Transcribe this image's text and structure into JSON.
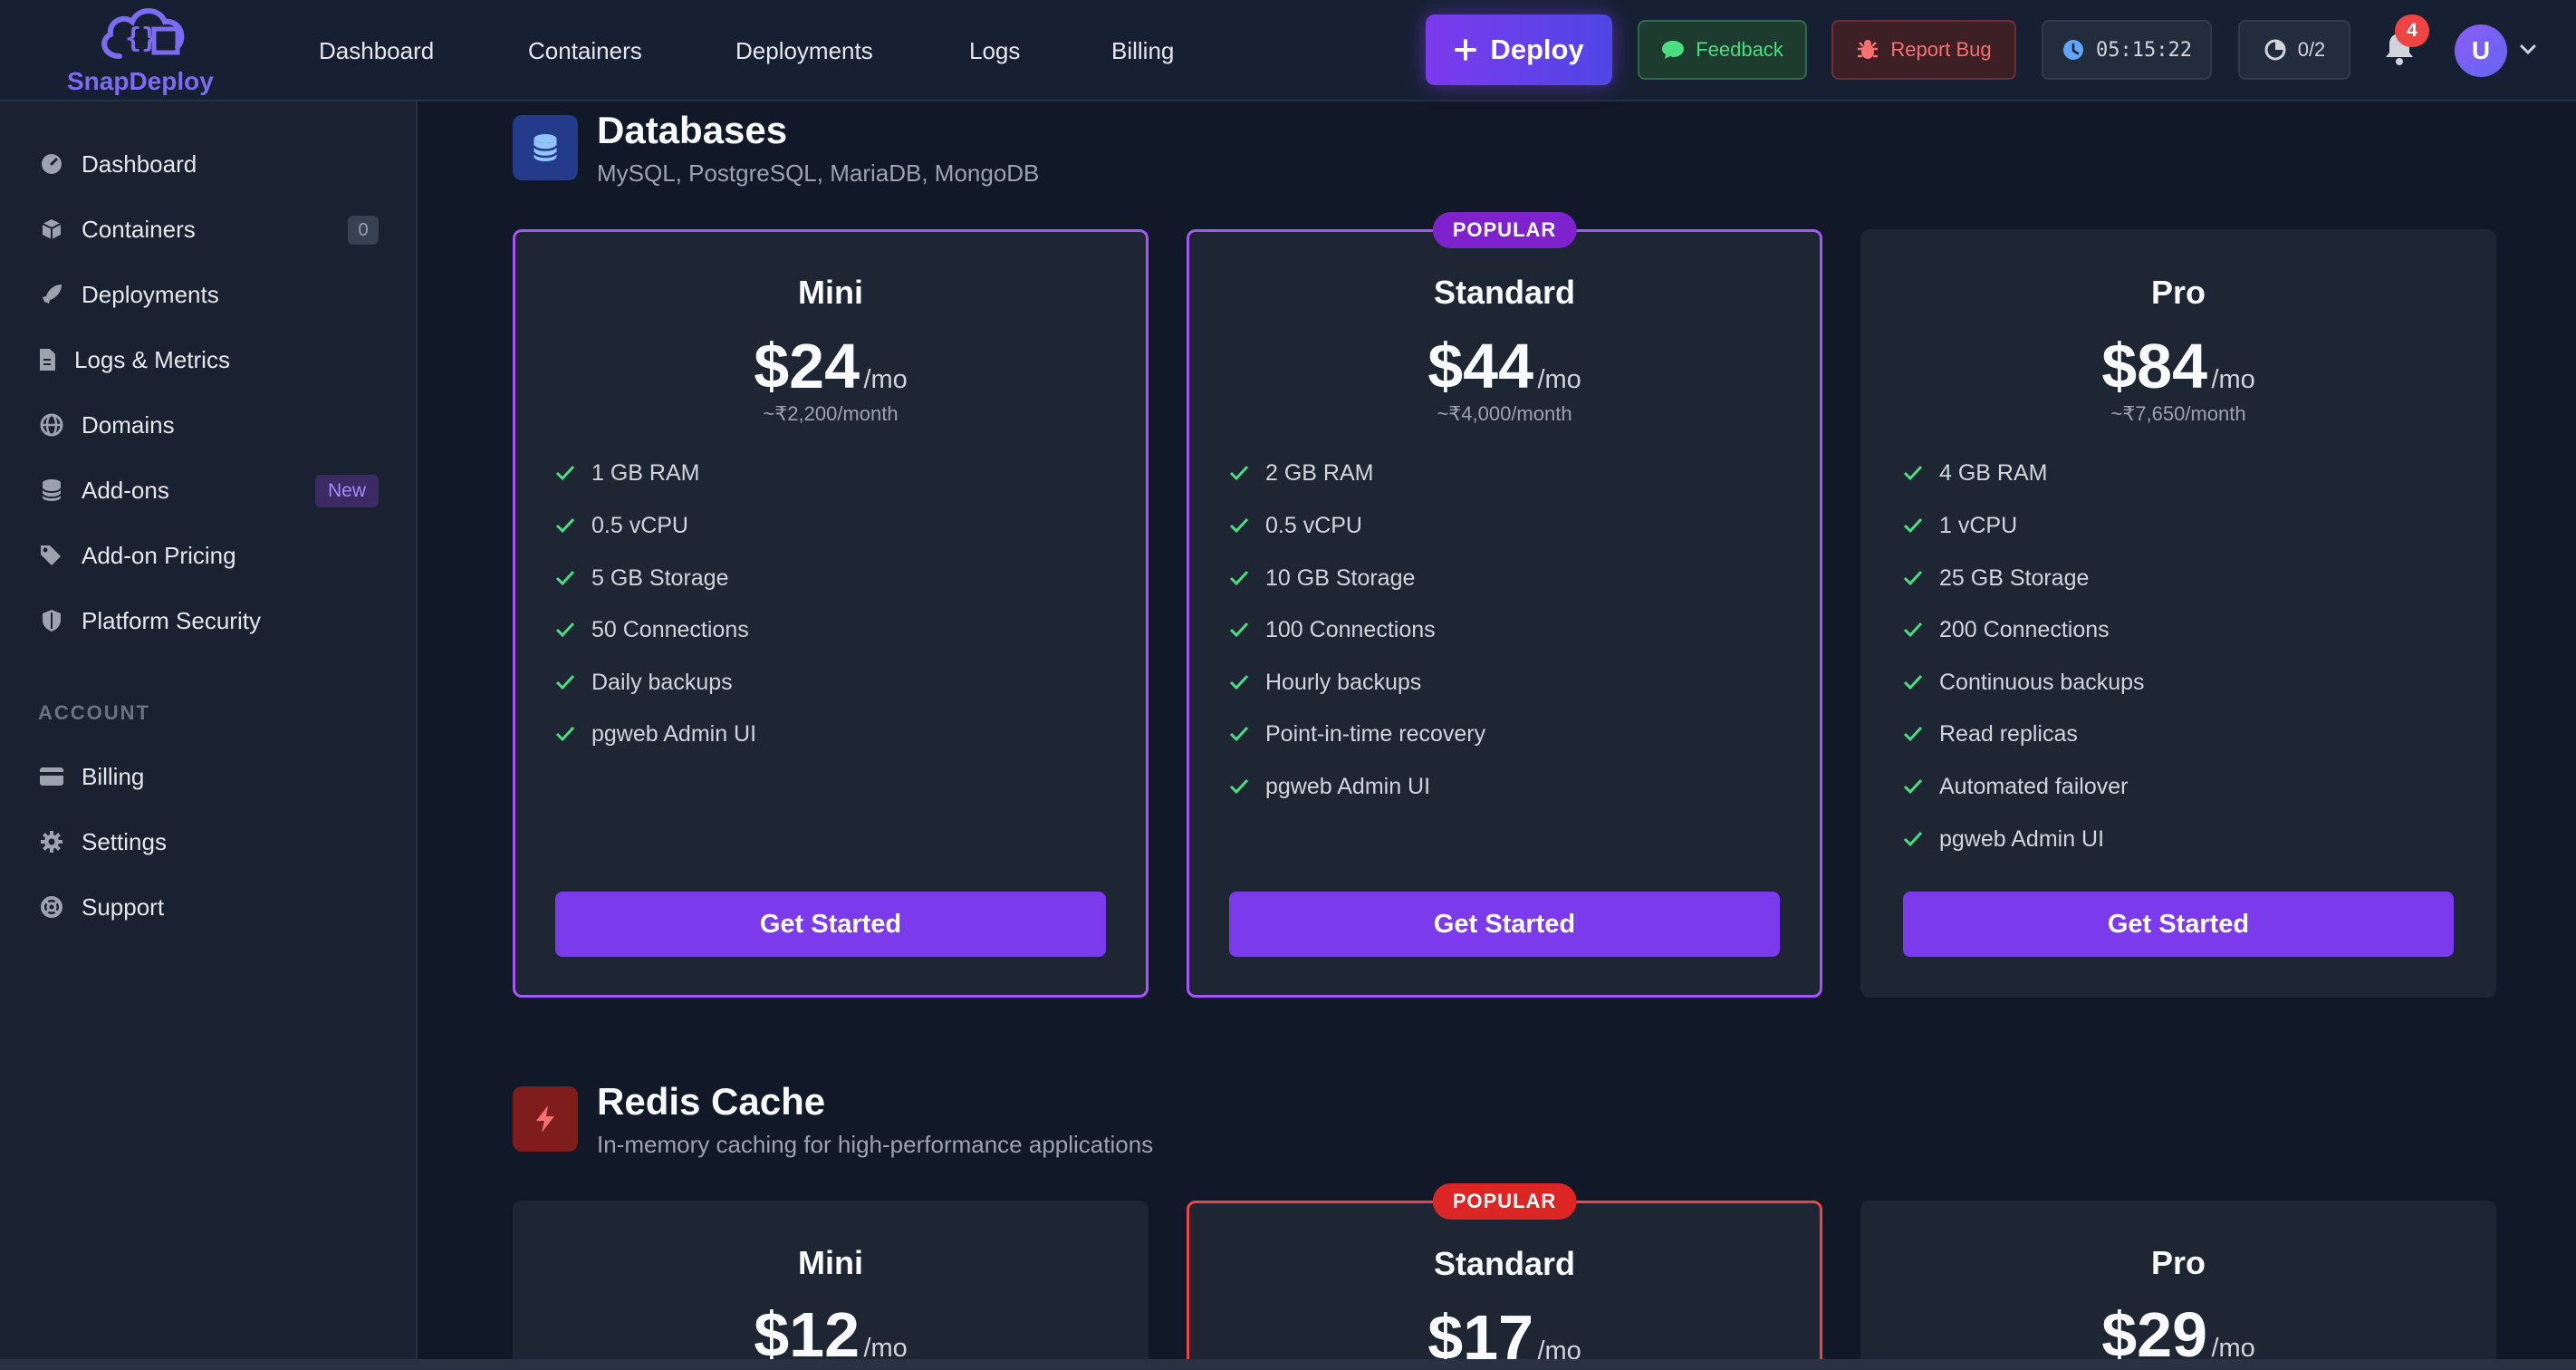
{
  "brand": {
    "name": "SnapDeploy",
    "accent": "#7c3aed"
  },
  "topnav": [
    "Dashboard",
    "Containers",
    "Deployments",
    "Logs",
    "Billing"
  ],
  "header": {
    "deploy_label": "Deploy",
    "feedback_label": "Feedback",
    "report_bug_label": "Report Bug",
    "timer": "05:15:22",
    "quota": "0/2",
    "notification_count": "4",
    "avatar_initial": "U"
  },
  "sidebar": {
    "items": [
      {
        "label": "Dashboard",
        "icon": "gauge-icon"
      },
      {
        "label": "Containers",
        "icon": "cube-icon",
        "count": "0"
      },
      {
        "label": "Deployments",
        "icon": "rocket-icon"
      },
      {
        "label": "Logs & Metrics",
        "icon": "file-icon"
      },
      {
        "label": "Domains",
        "icon": "globe-icon"
      },
      {
        "label": "Add-ons",
        "icon": "database-icon",
        "badge": "New"
      },
      {
        "label": "Add-on Pricing",
        "icon": "tags-icon"
      },
      {
        "label": "Platform Security",
        "icon": "shield-icon"
      }
    ],
    "account_heading": "ACCOUNT",
    "account_items": [
      {
        "label": "Billing",
        "icon": "credit-card-icon"
      },
      {
        "label": "Settings",
        "icon": "gear-icon"
      },
      {
        "label": "Support",
        "icon": "lifebuoy-icon"
      }
    ]
  },
  "databases": {
    "title": "Databases",
    "subtitle": "MySQL, PostgreSQL, MariaDB, MongoDB",
    "icon": "database-icon",
    "plans": [
      {
        "name": "Mini",
        "price": "$24",
        "per": "/mo",
        "inr": "~₹2,200/month",
        "features": [
          "1 GB RAM",
          "0.5 vCPU",
          "5 GB Storage",
          "50 Connections",
          "Daily backups",
          "pgweb Admin UI"
        ],
        "cta": "Get Started"
      },
      {
        "name": "Standard",
        "price": "$44",
        "per": "/mo",
        "inr": "~₹4,000/month",
        "popular": "POPULAR",
        "features": [
          "2 GB RAM",
          "0.5 vCPU",
          "10 GB Storage",
          "100 Connections",
          "Hourly backups",
          "Point-in-time recovery",
          "pgweb Admin UI"
        ],
        "cta": "Get Started"
      },
      {
        "name": "Pro",
        "price": "$84",
        "per": "/mo",
        "inr": "~₹7,650/month",
        "features": [
          "4 GB RAM",
          "1 vCPU",
          "25 GB Storage",
          "200 Connections",
          "Continuous backups",
          "Read replicas",
          "Automated failover",
          "pgweb Admin UI"
        ],
        "cta": "Get Started"
      }
    ]
  },
  "redis": {
    "title": "Redis Cache",
    "subtitle": "In-memory caching for high-performance applications",
    "icon": "bolt-icon",
    "plans": [
      {
        "name": "Mini",
        "price": "$12",
        "per": "/mo"
      },
      {
        "name": "Standard",
        "price": "$17",
        "per": "/mo",
        "popular": "POPULAR"
      },
      {
        "name": "Pro",
        "price": "$29",
        "per": "/mo"
      }
    ]
  },
  "colors": {
    "background": "#111827",
    "card": "#1f2633",
    "purple": "#a855f7",
    "red": "#ef4444",
    "check": "#4ade80"
  }
}
